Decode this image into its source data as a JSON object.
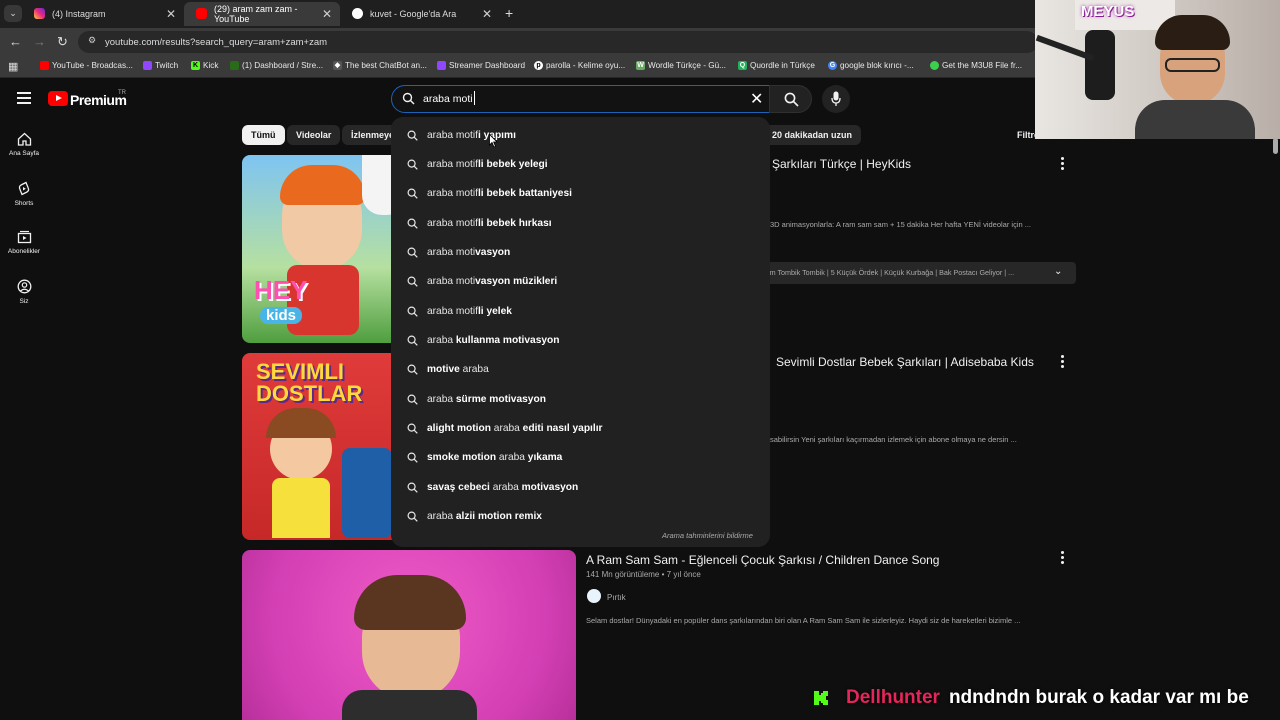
{
  "browser": {
    "tabs": [
      {
        "label": "(4) Instagram",
        "active": false,
        "icon": "instagram-icon"
      },
      {
        "label": "(29) aram zam zam - YouTube",
        "active": true,
        "icon": "youtube-icon"
      },
      {
        "label": "kuvet - Google'da Ara",
        "active": false,
        "icon": "google-icon"
      }
    ],
    "url": "youtube.com/results?search_query=aram+zam+zam",
    "bookmarks": [
      {
        "label": "YouTube - Broadcas...",
        "icon": "youtube-icon",
        "color": "#ff0000"
      },
      {
        "label": "Twitch",
        "icon": "twitch-icon",
        "color": "#9146ff"
      },
      {
        "label": "Kick",
        "icon": "kick-icon",
        "color": "#53fc18"
      },
      {
        "label": "(1) Dashboard / Stre...",
        "icon": "dashboard-icon",
        "color": "#53fc18"
      },
      {
        "label": "The best ChatBot an...",
        "icon": "chatbot-icon",
        "color": "#dddddd"
      },
      {
        "label": "Streamer Dashboard",
        "icon": "streamer-icon",
        "color": "#9146ff"
      },
      {
        "label": "parolla - Kelime oyu...",
        "icon": "parolla-icon",
        "color": "#ffffff"
      },
      {
        "label": "Wordle Türkçe - Gü...",
        "icon": "wordle-icon",
        "color": "#6aaa64"
      },
      {
        "label": "Quordle in Türkçe",
        "icon": "quordle-icon",
        "color": "#23b05a"
      },
      {
        "label": "google blok kırıcı -...",
        "icon": "google-icon",
        "color": "#4285f4"
      },
      {
        "label": "Get the M3U8 File fr...",
        "icon": "m3u8-icon",
        "color": "#3ccf4e"
      }
    ]
  },
  "youtube": {
    "brand": "Premium",
    "region": "TR",
    "search_value": "araba moti",
    "sidebar": [
      {
        "label": "Ana Sayfa",
        "icon": "home-icon"
      },
      {
        "label": "Shorts",
        "icon": "shorts-icon"
      },
      {
        "label": "Abonelikler",
        "icon": "subscriptions-icon"
      },
      {
        "label": "Siz",
        "icon": "account-icon"
      }
    ],
    "chips": [
      "Tümü",
      "Videolar",
      "İzlenmeye",
      "20 dakikadan uzun"
    ],
    "filters_label": "Filtrele",
    "results": [
      {
        "title_visible": "Şarkıları Türkçe | HeyKids",
        "desc": "3D animasyonlarla: A ram sam sam + 15 dakika Her hafta YENİ videolar için ...",
        "chapters": "im Tombik Tombik | 5 Küçük Ördek | Küçük Kurbağa | Bak Postacı Geliyor | ...",
        "thumb_text_top": "HEY",
        "thumb_text_bottom": "kids"
      },
      {
        "title_visible": "Sevimli Dostlar Bebek Şarkıları | Adisebaba Kids",
        "desc": "sabilirsin Yeni şarkıları kaçırmadan izlemek için abone olmaya ne dersin ...",
        "thumb_text_top": "SEVIMLI",
        "thumb_text_bottom": "DOSTLAR"
      },
      {
        "title_visible": "A Ram Sam Sam - Eğlenceli Çocuk Şarkısı / Children Dance Song",
        "views": "141 Mn görüntüleme",
        "age": "7 yıl önce",
        "channel": "Pırtık",
        "desc": "Selam dostlar! Dünyadaki en popüler dans şarkılarından biri olan A Ram Sam Sam ile sizlerleyiz. Haydi siz de hareketleri bizimle ..."
      }
    ],
    "suggestions": [
      {
        "pre": "araba motif",
        "bold": "i yapımı",
        "post": ""
      },
      {
        "pre": "araba motif",
        "bold": "li bebek yelegi",
        "post": ""
      },
      {
        "pre": "araba motif",
        "bold": "li bebek battaniyesi",
        "post": ""
      },
      {
        "pre": "araba motif",
        "bold": "li bebek hırkası",
        "post": ""
      },
      {
        "pre": "araba moti",
        "bold": "vasyon",
        "post": ""
      },
      {
        "pre": "araba moti",
        "bold": "vasyon müzikleri",
        "post": ""
      },
      {
        "pre": "araba motif",
        "bold": "li yelek",
        "post": ""
      },
      {
        "pre": "araba ",
        "bold": "kullanma motivasyon",
        "post": ""
      },
      {
        "pre": "",
        "bold": "motive",
        "post": " araba"
      },
      {
        "pre": "araba ",
        "bold": "sürme motivasyon",
        "post": ""
      },
      {
        "pre": "",
        "bold": "alight motion",
        "post": " araba",
        "bold2": " editi nasıl yapılır"
      },
      {
        "pre": "",
        "bold": "smoke motion",
        "post": " araba",
        "bold2": " yıkama"
      },
      {
        "pre": "",
        "bold": "savaş cebeci",
        "post": " araba",
        "bold2": " motivasyon"
      },
      {
        "pre": "araba ",
        "bold": "alzii motion remix",
        "post": ""
      }
    ],
    "suggest_report": "Arama tahminlerini bildirme"
  },
  "stream": {
    "webcam_name": "MEYUS",
    "chat_user": "Dellhunter",
    "chat_message": "ndndndn burak o kadar var mı be"
  },
  "colors": {
    "accent": "#1c62b9",
    "yt_red": "#ff0000",
    "kick_green": "#53fc18",
    "chat_user": "#e6265b"
  }
}
